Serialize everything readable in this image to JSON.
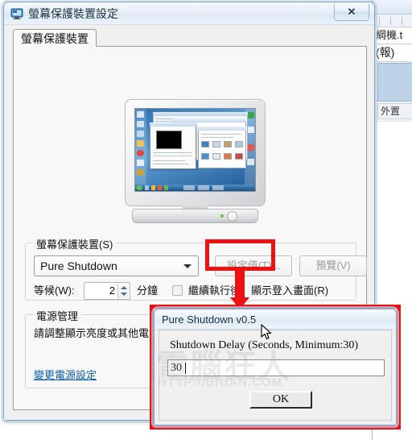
{
  "background_window": {
    "text_line_1": "綱機.t",
    "text_line_2": "(報)",
    "bottom_label": "外置"
  },
  "main_window": {
    "title": "螢幕保護裝置設定",
    "icon": "monitor-icon",
    "close_label": "✕",
    "tab": {
      "label": "螢幕保護裝置"
    },
    "screensaver_group": {
      "legend": "螢幕保護裝置(S)",
      "combo_value": "Pure Shutdown",
      "settings_button": "設定值(T)...",
      "preview_button": "預覽(V)",
      "wait_label": "等候(W):",
      "wait_value": "2",
      "wait_unit": "分鐘",
      "resume_label": "繼續執行後，顯示登入畫面(R)",
      "resume_checked": false
    },
    "power_group": {
      "legend": "電源管理",
      "description": "請調整顯示亮度或其他電源",
      "link": "變更電源設定"
    }
  },
  "pure_shutdown_dialog": {
    "title": "Pure Shutdown v0.5",
    "field_label": "Shutdown Delay (Seconds, Minimum:30)",
    "input_value": "30",
    "input_placeholder": "",
    "ok_button": "OK"
  },
  "annotations": {
    "highlight_color": "#ee1111",
    "arrow": "down-arrow",
    "cursor": "arrow-cursor"
  },
  "watermark": {
    "text_cn": "電腦狂人",
    "text_url": "HTTP://BRIAN.COM"
  }
}
